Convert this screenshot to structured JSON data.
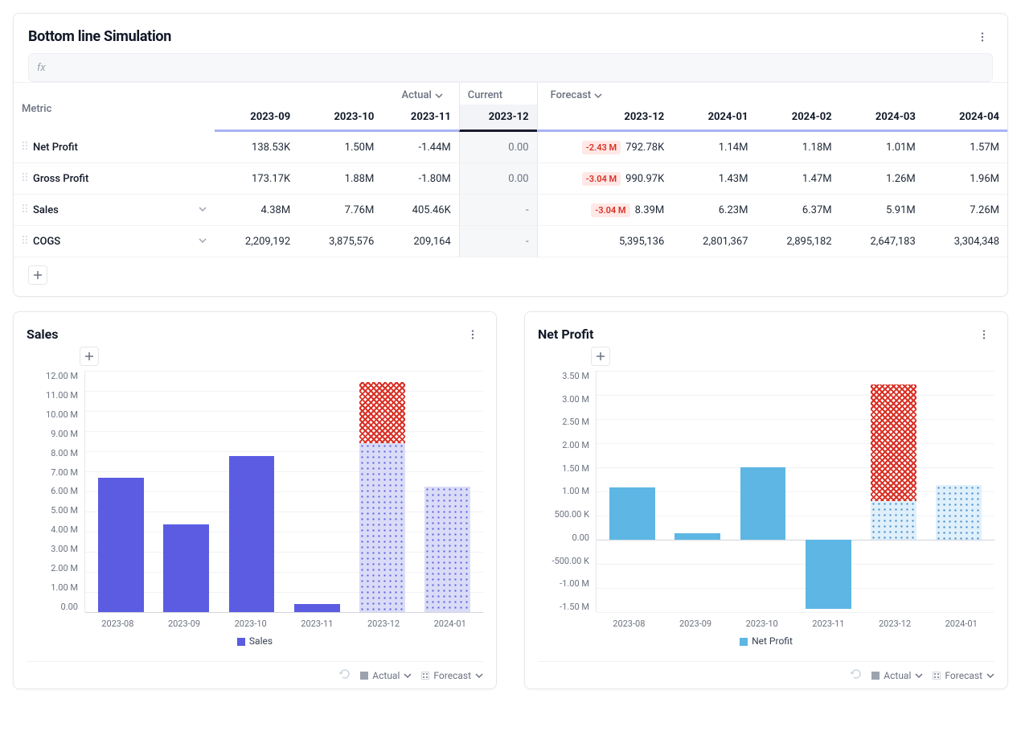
{
  "sim": {
    "title": "Bottom line Simulation",
    "fx_label": "fx",
    "group_actual": "Actual",
    "group_current": "Current",
    "group_forecast": "Forecast",
    "metric_col": "Metric",
    "cols": [
      "2023-09",
      "2023-10",
      "2023-11",
      "2023-12",
      "2023-12",
      "2024-01",
      "2024-02",
      "2024-03",
      "2024-04"
    ],
    "rows": [
      {
        "name": "Net Profit",
        "expandable": false,
        "cells": [
          "138.53K",
          "1.50M",
          "-1.44M",
          "0.00",
          {
            "delta": "-2.43 M",
            "val": "792.78K"
          },
          "1.14M",
          "1.18M",
          "1.01M",
          "1.57M"
        ]
      },
      {
        "name": "Gross Profit",
        "expandable": false,
        "cells": [
          "173.17K",
          "1.88M",
          "-1.80M",
          "0.00",
          {
            "delta": "-3.04 M",
            "val": "990.97K"
          },
          "1.43M",
          "1.47M",
          "1.26M",
          "1.96M"
        ]
      },
      {
        "name": "Sales",
        "expandable": true,
        "cells": [
          "4.38M",
          "7.76M",
          "405.46K",
          "-",
          {
            "delta": "-3.04 M",
            "val": "8.39M"
          },
          "6.23M",
          "6.37M",
          "5.91M",
          "7.26M"
        ]
      },
      {
        "name": "COGS",
        "expandable": true,
        "cells": [
          "2,209,192",
          "3,875,576",
          "209,164",
          "-",
          "5,395,136",
          "2,801,367",
          "2,895,182",
          "2,647,183",
          "3,304,348"
        ]
      }
    ]
  },
  "footer": {
    "actual": "Actual",
    "forecast": "Forecast"
  },
  "sales_chart": {
    "title": "Sales",
    "legend": "Sales"
  },
  "profit_chart": {
    "title": "Net Profit",
    "legend": "Net Profit"
  },
  "chart_data": [
    {
      "type": "bar",
      "name": "Sales",
      "categories": [
        "2023-08",
        "2023-09",
        "2023-10",
        "2023-11",
        "2023-12",
        "2024-01"
      ],
      "ylim": [
        0,
        12000000
      ],
      "ylabel": "",
      "ticks": [
        "12.00 M",
        "11.00 M",
        "10.00 M",
        "9.00 M",
        "8.00 M",
        "7.00 M",
        "6.00 M",
        "5.00 M",
        "4.00 M",
        "3.00 M",
        "2.00 M",
        "1.00 M",
        "0.00"
      ],
      "series": [
        {
          "name": "Sales Actual",
          "values": [
            6700000,
            4380000,
            7760000,
            405000,
            null,
            null
          ],
          "style": "solid",
          "color": "#5b5ce2"
        },
        {
          "name": "Sales Forecast",
          "values": [
            null,
            null,
            null,
            null,
            8390000,
            6230000
          ],
          "style": "dotted",
          "color": "#5b5ce2"
        },
        {
          "name": "Sales Delta Overlay",
          "values": [
            null,
            null,
            null,
            null,
            3040000,
            null
          ],
          "style": "hatched",
          "color": "#d93025",
          "stack_on": "Sales Forecast"
        }
      ]
    },
    {
      "type": "bar",
      "name": "Net Profit",
      "categories": [
        "2023-08",
        "2023-09",
        "2023-10",
        "2023-11",
        "2023-12",
        "2024-01"
      ],
      "ylim": [
        -1500000,
        3500000
      ],
      "ylabel": "",
      "ticks": [
        "3.50 M",
        "3.00 M",
        "2.50 M",
        "2.00 M",
        "1.50 M",
        "1.00 M",
        "500.00 K",
        "0.00",
        "-500.00 K",
        "-1.00 M",
        "-1.50 M"
      ],
      "series": [
        {
          "name": "Net Profit Actual",
          "values": [
            1080000,
            138530,
            1500000,
            -1440000,
            null,
            null
          ],
          "style": "solid",
          "color": "#5eb6e4"
        },
        {
          "name": "Net Profit Forecast",
          "values": [
            null,
            null,
            null,
            null,
            792780,
            1140000
          ],
          "style": "dotted",
          "color": "#5eb6e4"
        },
        {
          "name": "Net Profit Delta Overlay",
          "values": [
            null,
            null,
            null,
            null,
            2430000,
            null
          ],
          "style": "hatched",
          "color": "#d93025",
          "stack_on": "Net Profit Forecast"
        }
      ]
    }
  ]
}
